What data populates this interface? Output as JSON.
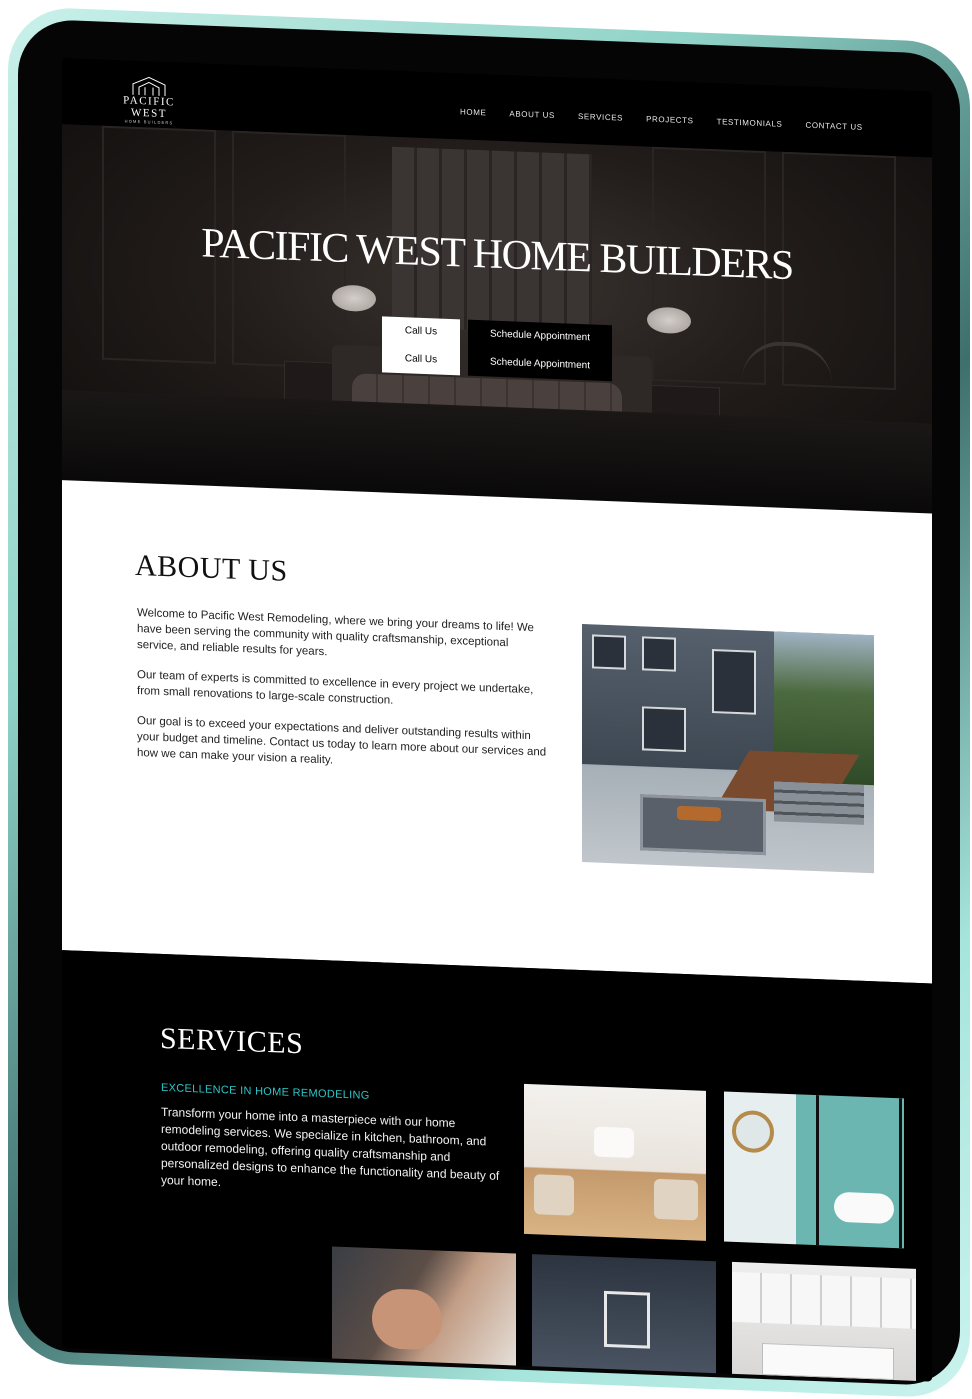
{
  "brand": {
    "name": "PACIFIC WEST",
    "tagline": "HOME BUILDERS"
  },
  "nav": {
    "items": [
      "HOME",
      "ABOUT US",
      "SERVICES",
      "PROJECTS",
      "TESTIMONIALS",
      "CONTACT US"
    ]
  },
  "hero": {
    "title": "PACIFIC WEST HOME BUILDERS",
    "call_label": "Call Us",
    "call_label_2": "Call Us",
    "schedule_label": "Schedule Appointment",
    "schedule_label_2": "Schedule Appointment"
  },
  "about": {
    "heading": "ABOUT US",
    "paragraphs": [
      "Welcome to Pacific West Remodeling, where we bring your dreams to life! We have been serving the community with quality craftsmanship, exceptional service, and reliable results for years.",
      "Our team of experts is committed to excellence in every project we undertake, from small renovations to large-scale construction.",
      "Our goal is to exceed your expectations and deliver outstanding results within your budget and timeline. Contact us today to learn more about our services and how we can make your vision a reality."
    ]
  },
  "services": {
    "heading": "SERVICES",
    "tagline": "EXCELLENCE IN HOME REMODELING",
    "description": "Transform your home into a masterpiece with our home remodeling services. We specialize in kitchen, bathroom, and outdoor remodeling, offering quality craftsmanship and personalized designs to enhance the functionality and beauty of your home."
  },
  "colors": {
    "accent": "#2ec4c6",
    "background": "#000000",
    "frame": "#8fd2c7"
  }
}
